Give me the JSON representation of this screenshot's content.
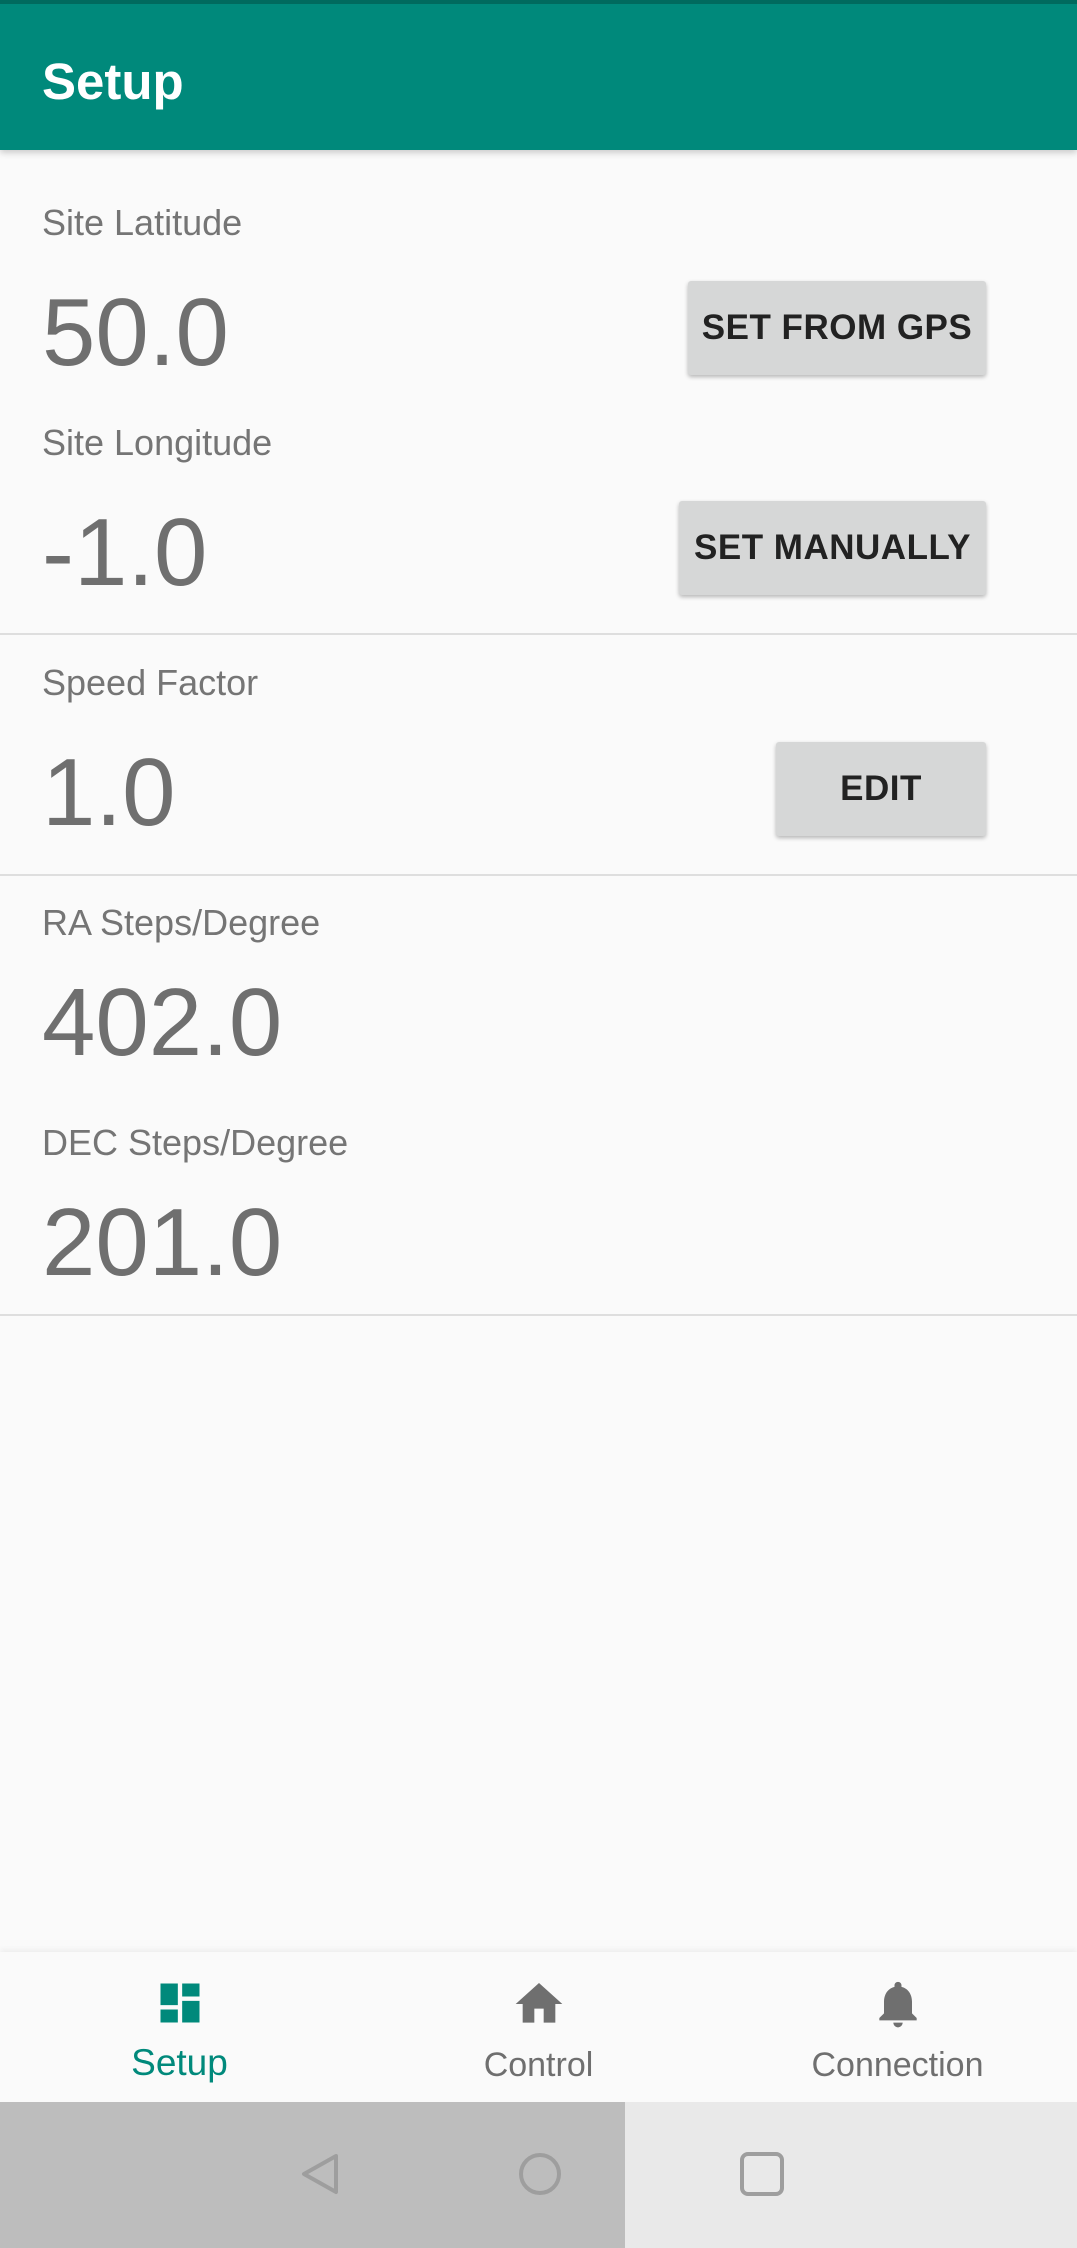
{
  "app_bar": {
    "title": "Setup"
  },
  "location": {
    "latitude_label": "Site Latitude",
    "latitude_value": "50.0",
    "set_from_gps_label": "SET FROM GPS",
    "longitude_label": "Site Longitude",
    "longitude_value": "-1.0",
    "set_manually_label": "SET MANUALLY"
  },
  "speed": {
    "label": "Speed Factor",
    "value": "1.0",
    "edit_label": "EDIT"
  },
  "steps": {
    "ra_label": "RA Steps/Degree",
    "ra_value": "402.0",
    "dec_label": "DEC Steps/Degree",
    "dec_value": "201.0"
  },
  "bottom_nav": {
    "items": [
      {
        "label": "Setup",
        "icon": "dashboard-icon",
        "active": true
      },
      {
        "label": "Control",
        "icon": "home-icon",
        "active": false
      },
      {
        "label": "Connection",
        "icon": "bell-icon",
        "active": false
      }
    ],
    "active_color": "#00897b",
    "inactive_color": "#6f6f6f"
  },
  "colors": {
    "primary": "#00897b",
    "button_bg": "#d6d7d7"
  }
}
